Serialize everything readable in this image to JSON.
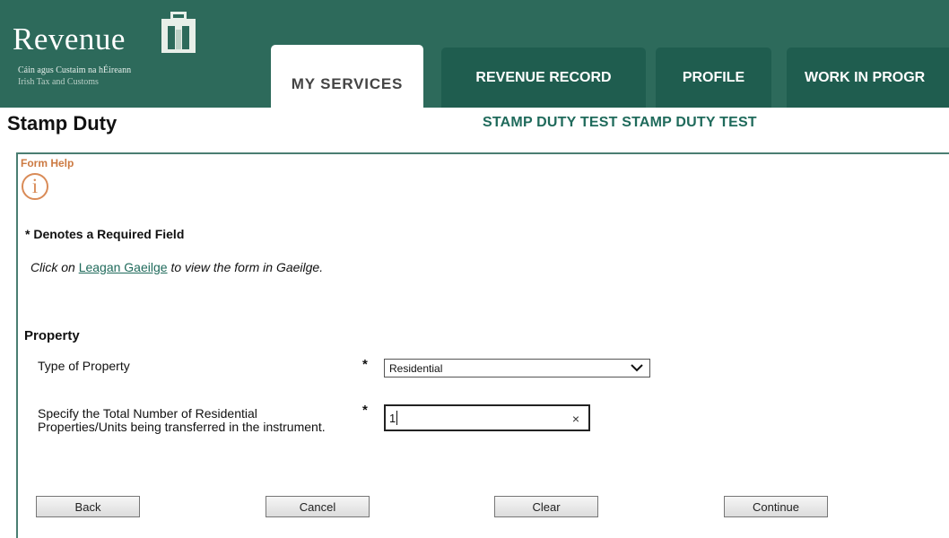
{
  "header": {
    "logo_title": "Revenue",
    "logo_line1": "Cáin agus Custaim na hÉireann",
    "logo_line2": "Irish Tax and Customs",
    "crest_icon": "harp-building-crest-icon",
    "tabs": [
      {
        "label": "MY SERVICES",
        "active": true
      },
      {
        "label": "REVENUE RECORD",
        "active": false
      },
      {
        "label": "PROFILE",
        "active": false
      },
      {
        "label": "WORK IN PROGR",
        "active": false
      }
    ]
  },
  "page": {
    "title": "Stamp Duty",
    "subtitle": "STAMP DUTY TEST STAMP DUTY TEST"
  },
  "form": {
    "help_label": "Form Help",
    "help_icon": "info-icon",
    "required_note": "* Denotes a Required Field",
    "click_prefix": "Click on ",
    "link_text": "Leagan Gaeilge",
    "click_suffix": " to view the form in Gaeilge.",
    "section_title": "Property",
    "fields": {
      "type_label": "Type of Property",
      "type_value": "Residential",
      "count_label": "Specify the Total Number of Residential Properties/Units being transferred in the instrument.",
      "count_value": "1",
      "required_mark": "*",
      "clear_icon": "×"
    },
    "buttons": {
      "back": "Back",
      "cancel": "Cancel",
      "clear": "Clear",
      "continue": "Continue"
    }
  },
  "colors": {
    "header_bg": "#2d6a5b",
    "tab_bg": "#1f5d4f",
    "accent": "#1f6a5b",
    "help_orange": "#cc7a42"
  }
}
